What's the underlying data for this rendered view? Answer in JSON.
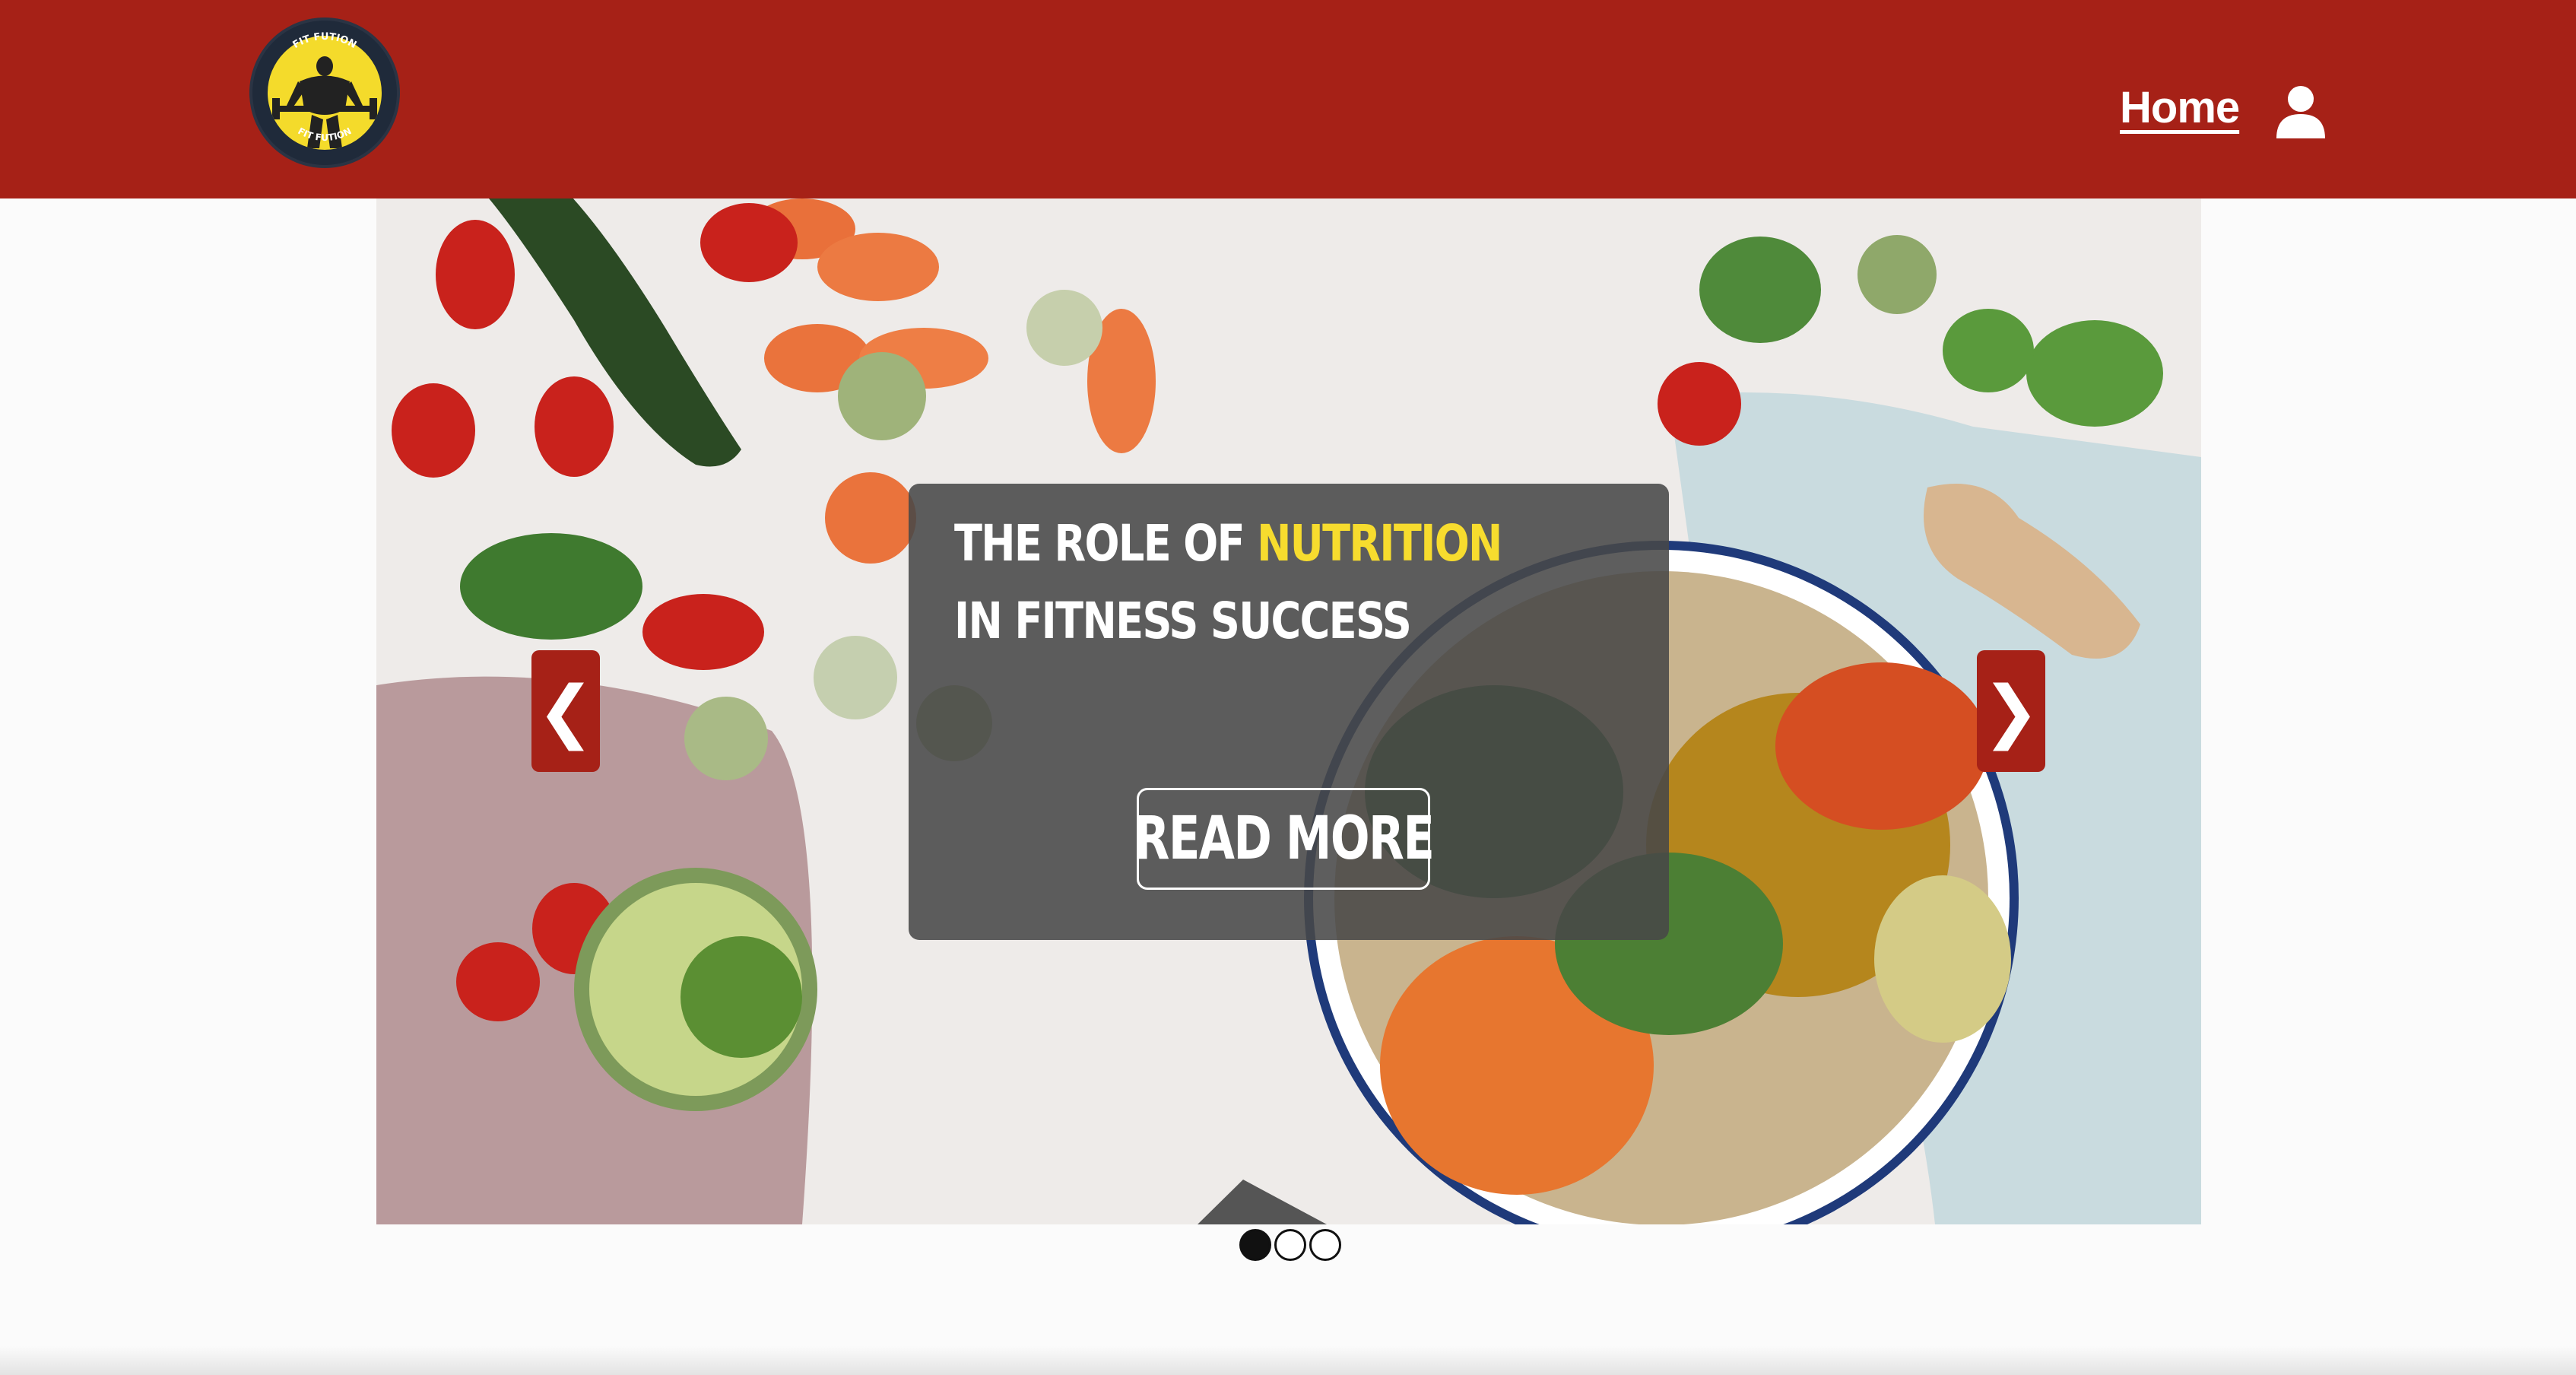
{
  "header": {
    "logo_name": "fit-fution-logo",
    "logo_text": "FIT FUTION",
    "nav": {
      "home_label": "Home"
    },
    "user_icon": "user-icon"
  },
  "carousel": {
    "slides_total": 3,
    "active_index": 0,
    "caption": {
      "title_part1": "THE ROLE OF ",
      "title_highlight": "NUTRITION",
      "title_part2": " IN FITNESS SUCCESS",
      "button_label": "READ MORE"
    },
    "prev_symbol": "❮",
    "next_symbol": "❯"
  },
  "colors": {
    "brand": "#a62117",
    "highlight": "#f7dc2e"
  }
}
